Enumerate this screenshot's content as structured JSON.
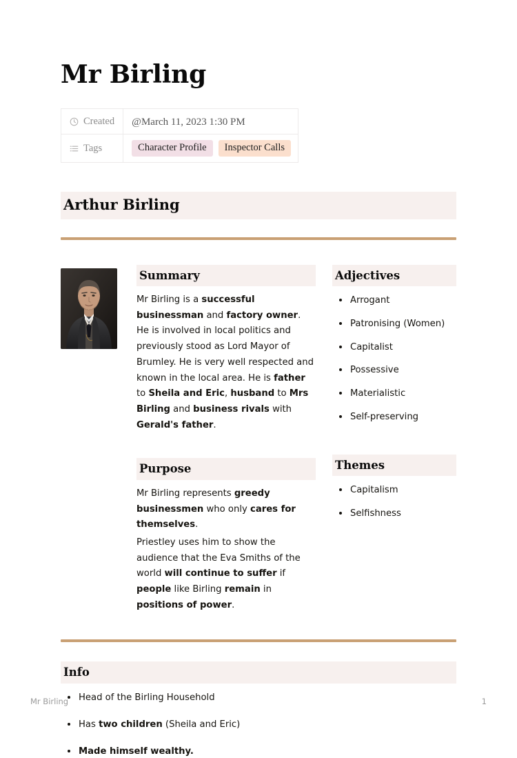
{
  "document": {
    "title": "Mr Birling"
  },
  "meta": {
    "created": {
      "icon": "clock-icon",
      "label": "Created",
      "value": "@March 11, 2023 1:30 PM"
    },
    "tags": {
      "icon": "list-icon",
      "label": "Tags",
      "values": [
        {
          "text": "Character Profile",
          "color": "#f2dfe6"
        },
        {
          "text": "Inspector Calls",
          "color": "#fbdfcd"
        }
      ]
    }
  },
  "section_heading": "Arthur Birling",
  "portrait": {
    "alt": "Portrait of Arthur Birling, an older man in a dark three-piece suit"
  },
  "summary": {
    "heading": "Summary",
    "parts": [
      {
        "text": "Mr Birling is a ",
        "bold": false
      },
      {
        "text": "successful businessman",
        "bold": true
      },
      {
        "text": " and ",
        "bold": false
      },
      {
        "text": "factory owner",
        "bold": true
      },
      {
        "text": ". He is involved in local politics and previously stood as Lord Mayor of Brumley. He is very well respected and known in the local area. He is ",
        "bold": false
      },
      {
        "text": "father",
        "bold": true
      },
      {
        "text": " to ",
        "bold": false
      },
      {
        "text": "Sheila and Eric",
        "bold": true
      },
      {
        "text": ", ",
        "bold": false
      },
      {
        "text": "husband",
        "bold": true
      },
      {
        "text": " to ",
        "bold": false
      },
      {
        "text": "Mrs Birling",
        "bold": true
      },
      {
        "text": " and ",
        "bold": false
      },
      {
        "text": "business rivals",
        "bold": true
      },
      {
        "text": " with ",
        "bold": false
      },
      {
        "text": "Gerald's father",
        "bold": true
      },
      {
        "text": ".",
        "bold": false
      }
    ]
  },
  "purpose": {
    "heading": "Purpose",
    "paragraph1": [
      {
        "text": "Mr Birling represents ",
        "bold": false
      },
      {
        "text": "greedy businessmen",
        "bold": true
      },
      {
        "text": " who only ",
        "bold": false
      },
      {
        "text": "cares for themselves",
        "bold": true
      },
      {
        "text": ".",
        "bold": false
      }
    ],
    "paragraph2": [
      {
        "text": "Priestley uses him to show the audience that the Eva Smiths of the world ",
        "bold": false
      },
      {
        "text": "will continue to suffer",
        "bold": true
      },
      {
        "text": " if ",
        "bold": false
      },
      {
        "text": "people",
        "bold": true
      },
      {
        "text": " like Birling ",
        "bold": false
      },
      {
        "text": "remain",
        "bold": true
      },
      {
        "text": " in ",
        "bold": false
      },
      {
        "text": "positions of power",
        "bold": true
      },
      {
        "text": ".",
        "bold": false
      }
    ]
  },
  "adjectives": {
    "heading": "Adjectives",
    "items": [
      "Arrogant",
      "Patronising (Women)",
      "Capitalist",
      "Possessive",
      "Materialistic",
      "Self-preserving"
    ]
  },
  "themes": {
    "heading": "Themes",
    "items": [
      "Capitalism",
      "Selfishness"
    ]
  },
  "info": {
    "heading": "Info",
    "items": [
      [
        {
          "text": "Head of the Birling Household",
          "bold": false
        }
      ],
      [
        {
          "text": "Has ",
          "bold": false
        },
        {
          "text": "two children",
          "bold": true
        },
        {
          "text": " (Sheila and Eric)",
          "bold": false
        }
      ],
      [
        {
          "text": "Made himself wealthy.",
          "bold": true
        }
      ]
    ]
  },
  "footer": {
    "left": "Mr Birling",
    "page_number": "1"
  },
  "colors": {
    "rule": "#c9a074",
    "heading_band": "#f7f0ee",
    "tag_pink": "#f2dfe6",
    "tag_peach": "#fbdfcd"
  }
}
